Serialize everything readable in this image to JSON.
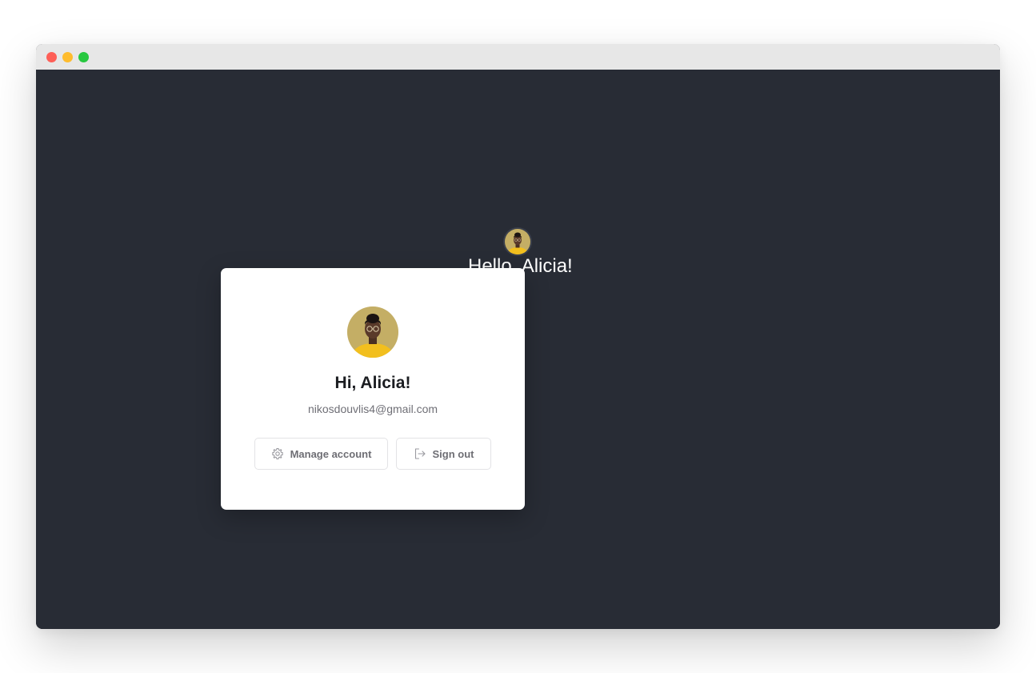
{
  "page": {
    "hello_text": "Hello, Alicia!"
  },
  "card": {
    "greeting": "Hi, Alicia!",
    "email": "nikosdouvlis4@gmail.com",
    "manage_label": "Manage account",
    "signout_label": "Sign out"
  },
  "icons": {
    "manage": "gear-icon",
    "signout": "sign-out-icon"
  },
  "colors": {
    "background": "#282c35",
    "card": "#ffffff",
    "avatar_bg": "#c9b46b",
    "avatar_shirt": "#f2bf1e",
    "button_text": "#6e6e74"
  }
}
